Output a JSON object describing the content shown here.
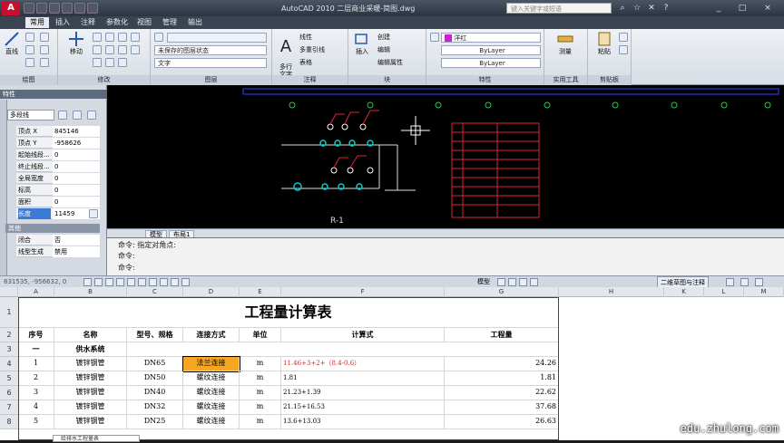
{
  "titlebar": {
    "app_logo": "A",
    "window_title": "AutoCAD 2010    二层商业采暖-简图.dwg",
    "search_placeholder": "键入关键字或短语",
    "buttons": [
      "?",
      "_",
      "□",
      "×"
    ]
  },
  "menu": [
    "常用",
    "插入",
    "注释",
    "参数化",
    "视图",
    "管理",
    "输出"
  ],
  "ribbon": {
    "draw_panel": {
      "title": "绘图",
      "line_label": "直线"
    },
    "modify_panel": {
      "title": "修改",
      "move_label": "移动"
    },
    "layer_panel": {
      "title": "图层",
      "layer_state": "未保存的图层状态",
      "layer_current": "文字"
    },
    "annotation_panel": {
      "title": "注释",
      "text_label": "多行\n文字",
      "linear_label": "线性",
      "multileader_label": "多重引线",
      "table_label": "表格"
    },
    "block_panel": {
      "title": "块",
      "insert_label": "插入",
      "create_label": "创建",
      "edit_label": "编辑",
      "edit_attr_label": "编辑属性"
    },
    "properties_panel": {
      "title": "特性",
      "color": "洋红",
      "linetype": "ByLayer",
      "lineweight": "ByLayer"
    },
    "utilities_panel": {
      "title": "实用工具",
      "measure_label": "测量"
    },
    "clipboard_panel": {
      "title": "剪贴板",
      "paste_label": "粘贴"
    }
  },
  "properties": {
    "header": "特性",
    "object_type": "多段线",
    "rows": [
      {
        "key": "顶点 X",
        "value": "845146"
      },
      {
        "key": "顶点 Y",
        "value": "-958626"
      },
      {
        "key": "起始线段...",
        "value": "0"
      },
      {
        "key": "终止线段...",
        "value": "0"
      },
      {
        "key": "全局宽度",
        "value": "0"
      },
      {
        "key": "标高",
        "value": "0"
      },
      {
        "key": "面积",
        "value": "0"
      },
      {
        "key": "长度",
        "value": "11459"
      }
    ],
    "misc_section": "其他",
    "misc_rows": [
      {
        "key": "闭合",
        "value": "否"
      },
      {
        "key": "线型生成",
        "value": "禁用"
      }
    ]
  },
  "drawing": {
    "label": "R-1",
    "tabs": [
      "模型",
      "布局1"
    ]
  },
  "command": {
    "line1": "命令: 指定对角点:",
    "line2": "命令:",
    "line3": "命令:"
  },
  "status": {
    "coords": "831535, -956632, 0",
    "model_label": "模型",
    "workspace": "二维草图与注释"
  },
  "spreadsheet": {
    "columns": [
      "A",
      "B",
      "C",
      "D",
      "E",
      "F",
      "G",
      "H",
      "I",
      "J",
      "K",
      "L",
      "M"
    ],
    "title": "工程量计算表",
    "headers": [
      "序号",
      "名称",
      "型号、规格",
      "连接方式",
      "单位",
      "计算式",
      "工程量"
    ],
    "section": {
      "num": "一",
      "name": "供水系统"
    },
    "rows": [
      {
        "row": "4",
        "num": "1",
        "name": "镀锌钢管",
        "spec": "DN65",
        "conn": "法兰连接",
        "unit": "m",
        "formula": "11.46+3+2+（8.4-0.6）",
        "qty": "24.26"
      },
      {
        "row": "5",
        "num": "2",
        "name": "镀锌钢管",
        "spec": "DN50",
        "conn": "螺纹连接",
        "unit": "m",
        "formula": "1.81",
        "qty": "1.81"
      },
      {
        "row": "6",
        "num": "3",
        "name": "镀锌钢管",
        "spec": "DN40",
        "conn": "螺纹连接",
        "unit": "m",
        "formula": "21.23+1.39",
        "qty": "22.62"
      },
      {
        "row": "7",
        "num": "4",
        "name": "镀锌钢管",
        "spec": "DN32",
        "conn": "螺纹连接",
        "unit": "m",
        "formula": "21.15+16.53",
        "qty": "37.68"
      },
      {
        "row": "8",
        "num": "5",
        "name": "镀锌钢管",
        "spec": "DN25",
        "conn": "螺纹连接",
        "unit": "m",
        "formula": "13.6+13.03",
        "qty": "26.63"
      }
    ],
    "sheet_tab": "给排水工程量表"
  },
  "watermark": "edu.zhulong.com",
  "colors": {
    "highlight_cell": "#f5a623",
    "cad_bg": "#000000",
    "pipe_cyan": "#00d0d0",
    "table_red": "#e0243c"
  }
}
